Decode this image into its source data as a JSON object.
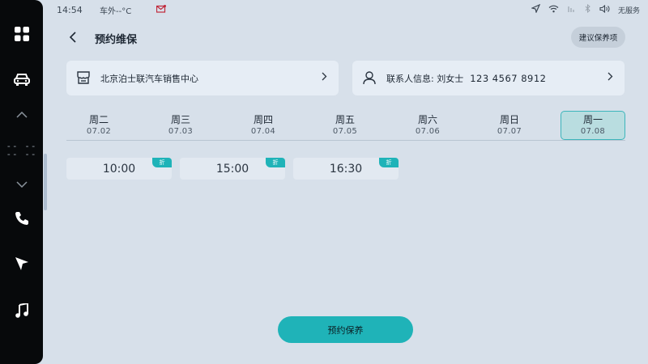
{
  "status_bar": {
    "time": "14:54",
    "outside_temp": "车外--°C",
    "service": "无服务"
  },
  "dock": {
    "hvac_temp": "-- --\n-- --"
  },
  "header": {
    "title": "预约维保",
    "suggest_label": "建议保养项"
  },
  "dealer_card": {
    "name": "北京泊士联汽车销售中心"
  },
  "contact_card": {
    "label": "联系人信息: 刘女士",
    "phone": "123 4567 8912"
  },
  "date_tabs": [
    {
      "weekday": "周二",
      "date": "07.02"
    },
    {
      "weekday": "周三",
      "date": "07.03"
    },
    {
      "weekday": "周四",
      "date": "07.04"
    },
    {
      "weekday": "周五",
      "date": "07.05"
    },
    {
      "weekday": "周六",
      "date": "07.06"
    },
    {
      "weekday": "周日",
      "date": "07.07"
    },
    {
      "weekday": "周一",
      "date": "07.08"
    }
  ],
  "selected_date_index": 6,
  "time_slots": [
    {
      "time": "10:00",
      "tag": "折"
    },
    {
      "time": "15:00",
      "tag": "折"
    },
    {
      "time": "16:30",
      "tag": "折"
    }
  ],
  "submit_label": "预约保养",
  "colors": {
    "accent": "#1fb3b8",
    "background": "#d7e0ea",
    "card": "#e6edf5",
    "dock": "#07090b"
  }
}
